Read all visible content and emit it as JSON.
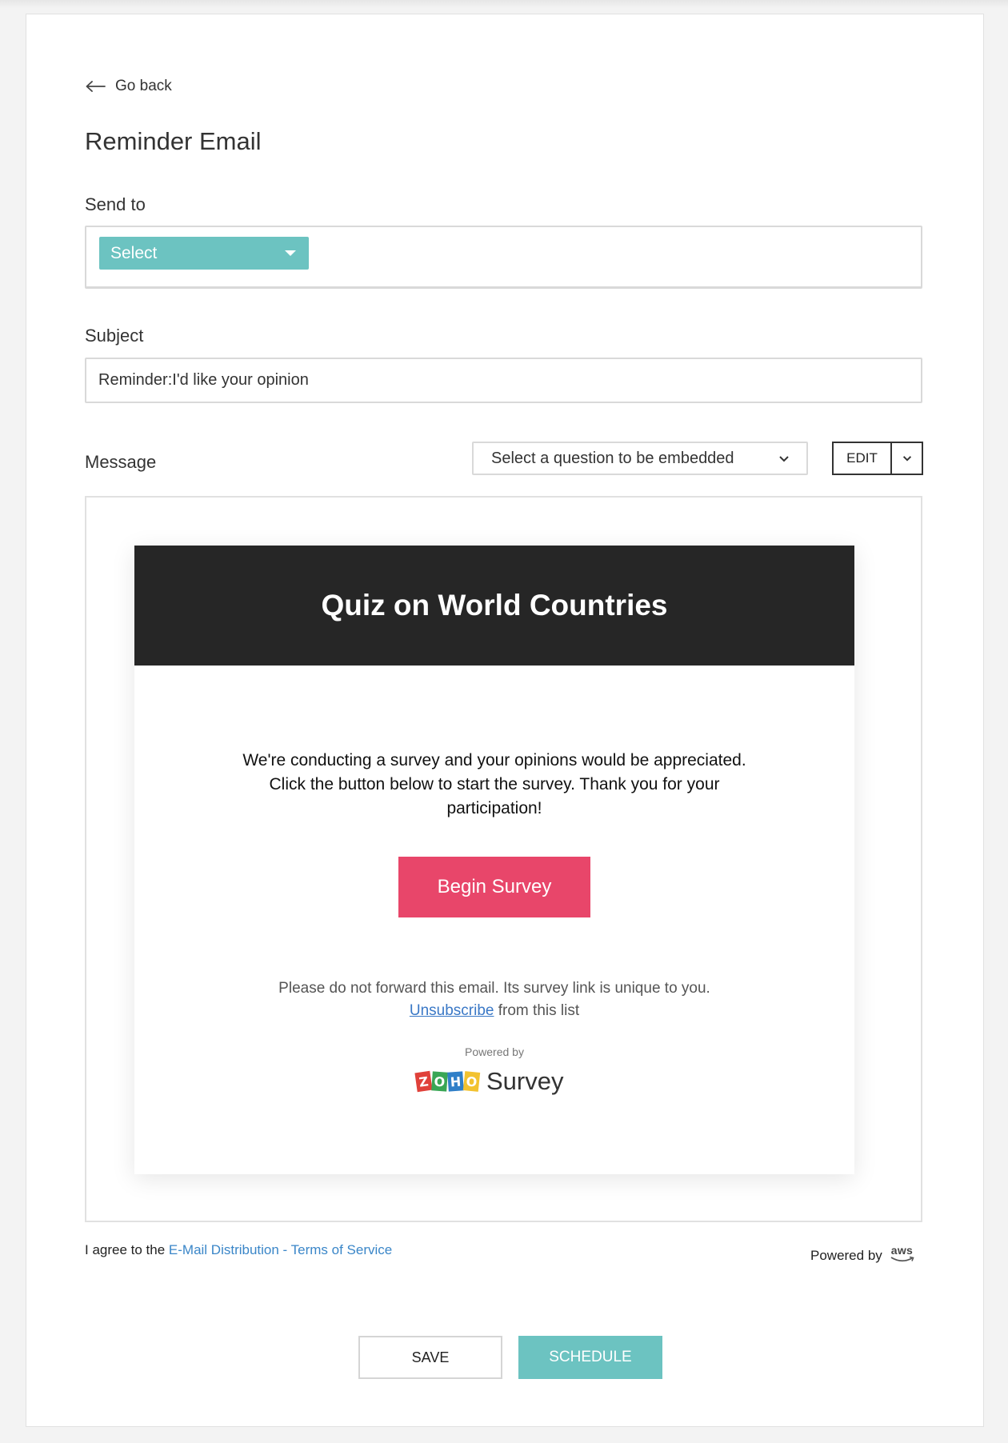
{
  "nav": {
    "back_label": "Go back"
  },
  "page": {
    "title": "Reminder Email"
  },
  "send_to": {
    "label": "Send to",
    "select_label": "Select"
  },
  "subject": {
    "label": "Subject",
    "value": "Reminder:I'd like your opinion"
  },
  "message": {
    "label": "Message",
    "embed_select_label": "Select a question to be embedded",
    "edit_label": "EDIT"
  },
  "email": {
    "title": "Quiz on World Countries",
    "body": "We're conducting a survey and your opinions would be appreciated. Click the button below to start the survey. Thank you for your participation!",
    "button_label": "Begin Survey",
    "forward_note": "Please do not forward this email. Its survey link is unique to you.",
    "unsubscribe_link": "Unsubscribe",
    "unsubscribe_suffix": " from this list",
    "powered_by": "Powered by",
    "logo_letters": [
      "Z",
      "O",
      "H",
      "O"
    ],
    "logo_colors": [
      "#e0413a",
      "#3aa655",
      "#2f7fc8",
      "#f2c230"
    ],
    "logo_word": "Survey"
  },
  "footer": {
    "agree_prefix": "I agree to the ",
    "terms_link": "E-Mail Distribution - Terms of Service",
    "powered_by": "Powered by",
    "aws_text": "aws"
  },
  "actions": {
    "save_label": "SAVE",
    "schedule_label": "SCHEDULE"
  },
  "colors": {
    "accent": "#6cc3c1",
    "begin_button": "#e8466a",
    "email_header": "#262626",
    "link": "#3a86c8"
  }
}
